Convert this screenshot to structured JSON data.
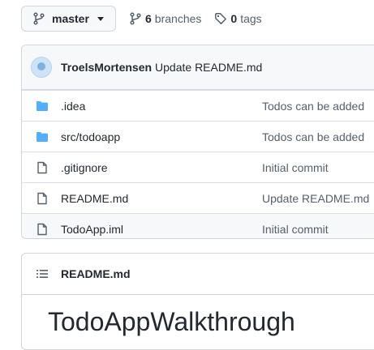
{
  "branch": {
    "name": "master"
  },
  "meta": {
    "branches_count": "6",
    "branches_label": "branches",
    "tags_count": "0",
    "tags_label": "tags"
  },
  "commit": {
    "author": "TroelsMortensen",
    "message": "Update README.md"
  },
  "files": [
    {
      "type": "folder",
      "name": ".idea",
      "message": "Todos can be added"
    },
    {
      "type": "folder",
      "name": "src/todoapp",
      "message": "Todos can be added"
    },
    {
      "type": "file",
      "name": ".gitignore",
      "message": "Initial commit"
    },
    {
      "type": "file",
      "name": "README.md",
      "message": "Update README.md"
    },
    {
      "type": "file",
      "name": "TodoApp.iml",
      "message": "Initial commit"
    }
  ],
  "readme": {
    "filename": "README.md",
    "heading": "TodoAppWalkthrough"
  },
  "colors": {
    "folder": "#54aeff",
    "muted": "#57606a",
    "border": "#d0d7de"
  }
}
